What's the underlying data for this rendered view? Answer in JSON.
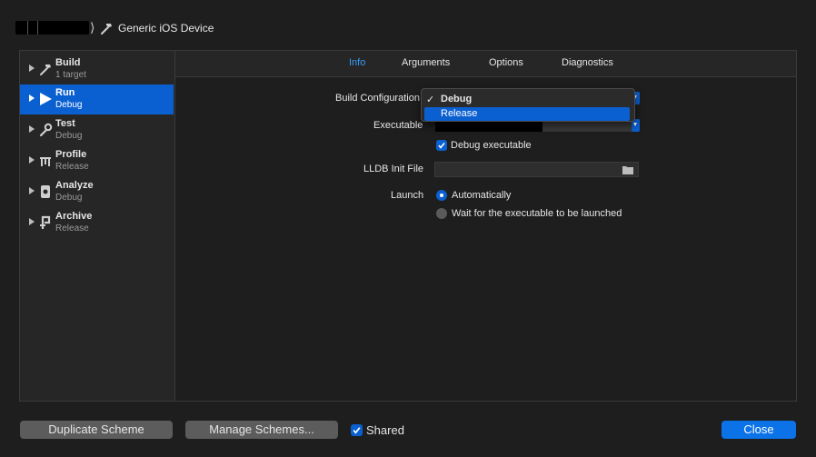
{
  "header": {
    "breadcrumb_sep": "⟩",
    "device": "Generic iOS Device"
  },
  "sidebar": {
    "items": [
      {
        "title": "Build",
        "sub": "1 target",
        "icon": "hammer-icon"
      },
      {
        "title": "Run",
        "sub": "Debug",
        "icon": "play-icon",
        "selected": true
      },
      {
        "title": "Test",
        "sub": "Debug",
        "icon": "wrench-icon"
      },
      {
        "title": "Profile",
        "sub": "Release",
        "icon": "instruments-icon"
      },
      {
        "title": "Analyze",
        "sub": "Debug",
        "icon": "analyze-icon"
      },
      {
        "title": "Archive",
        "sub": "Release",
        "icon": "archive-icon"
      }
    ]
  },
  "tabs": [
    "Info",
    "Arguments",
    "Options",
    "Diagnostics"
  ],
  "active_tab": "Info",
  "form": {
    "build_config_label": "Build Configuration",
    "executable_label": "Executable",
    "debug_exec_label": "Debug executable",
    "lldb_label": "LLDB Init File",
    "launch_label": "Launch",
    "launch_auto": "Automatically",
    "launch_wait": "Wait for the executable to be launched"
  },
  "popup": {
    "options": [
      "Debug",
      "Release"
    ],
    "selected": "Debug",
    "check": "✓"
  },
  "footer": {
    "duplicate": "Duplicate Scheme",
    "manage": "Manage Schemes...",
    "shared": "Shared",
    "close": "Close"
  },
  "colors": {
    "accent": "#0b60d1",
    "tab_active": "#3b9af8",
    "background": "#1e1e1e"
  }
}
